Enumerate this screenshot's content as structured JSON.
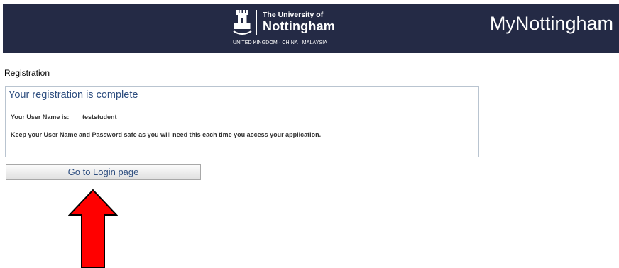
{
  "header": {
    "logo_line1": "The University of",
    "logo_line2": "Nottingham",
    "logo_tagline": "UNITED KINGDOM · CHINA · MALAYSIA",
    "app_title": "MyNottingham",
    "background_color": "#242a45"
  },
  "page": {
    "section_title": "Registration"
  },
  "panel": {
    "heading": "Your registration is complete",
    "username_label": "Your User Name is:",
    "username_value": "teststudent",
    "notice": "Keep your User Name and Password safe as you will need this each time you access your application."
  },
  "actions": {
    "login_button_label": "Go to Login page"
  },
  "annotation": {
    "icon": "arrow-up-icon",
    "color": "#ff0000"
  }
}
